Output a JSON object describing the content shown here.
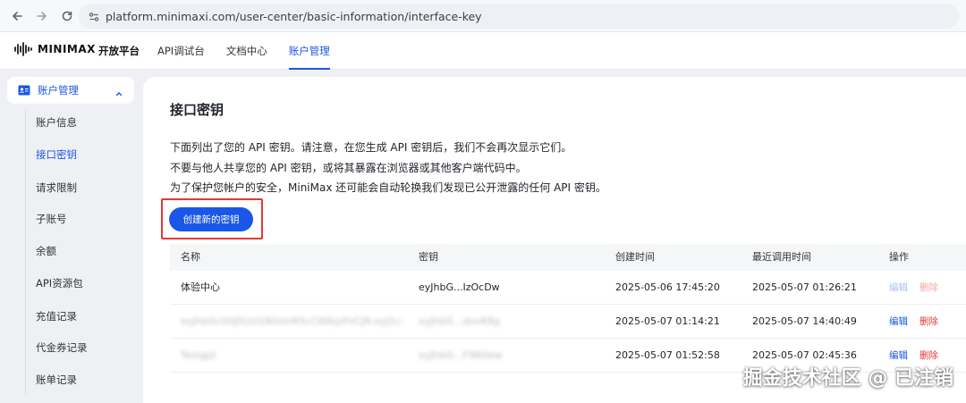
{
  "browser": {
    "url": "platform.minimaxi.com/user-center/basic-information/interface-key"
  },
  "header": {
    "logo_text": "MINIMAX",
    "platform_name": "开放平台",
    "nav": [
      {
        "label": "API调试台"
      },
      {
        "label": "文档中心"
      },
      {
        "label": "账户管理",
        "active": true
      }
    ]
  },
  "sidebar": {
    "group_label": "账户管理",
    "items": [
      {
        "label": "账户信息"
      },
      {
        "label": "接口密钥",
        "active": true
      },
      {
        "label": "请求限制"
      },
      {
        "label": "子账号"
      },
      {
        "label": "余额"
      },
      {
        "label": "API资源包"
      },
      {
        "label": "充值记录"
      },
      {
        "label": "代金券记录"
      },
      {
        "label": "账单记录"
      }
    ]
  },
  "main": {
    "title": "接口密钥",
    "description": [
      "下面列出了您的 API 密钥。请注意，在您生成 API 密钥后，我们不会再次显示它们。",
      "不要与他人共享您的 API 密钥，或将其暴露在浏览器或其他客户端代码中。",
      "为了保护您帐户的安全，MiniMax 还可能会自动轮换我们发现已公开泄露的任何 API 密钥。"
    ],
    "create_button": "创建新的密钥",
    "table": {
      "headers": [
        "名称",
        "密钥",
        "创建时间",
        "最近调用时间",
        "操作"
      ],
      "rows": [
        {
          "name": "体验中心",
          "key": "eyJhbG...IzOcDw",
          "created": "2025-05-06 17:45:20",
          "last_used": "2025-05-07 01:26:21",
          "edit": "编辑",
          "delete": "删除"
        },
        {
          "name": "eyJhbGciOiJSUzI1NiIsInR5cCI6IkpXVCJ9.eyJ1c2VySWQi",
          "key": "eyJhbG...dovK8g",
          "created": "2025-05-07 01:14:21",
          "last_used": "2025-05-07 14:40:49",
          "edit": "编辑",
          "delete": "删除"
        },
        {
          "name": "Testgpt",
          "key": "eyJhbG...F9BXew",
          "created": "2025-05-07 01:52:58",
          "last_used": "2025-05-07 02:45:36",
          "edit": "编辑",
          "delete": "删除"
        }
      ]
    }
  },
  "watermark": "掘金技术社区 @ 已注销",
  "colors": {
    "accent": "#1a56e8",
    "danger": "#e53935"
  }
}
